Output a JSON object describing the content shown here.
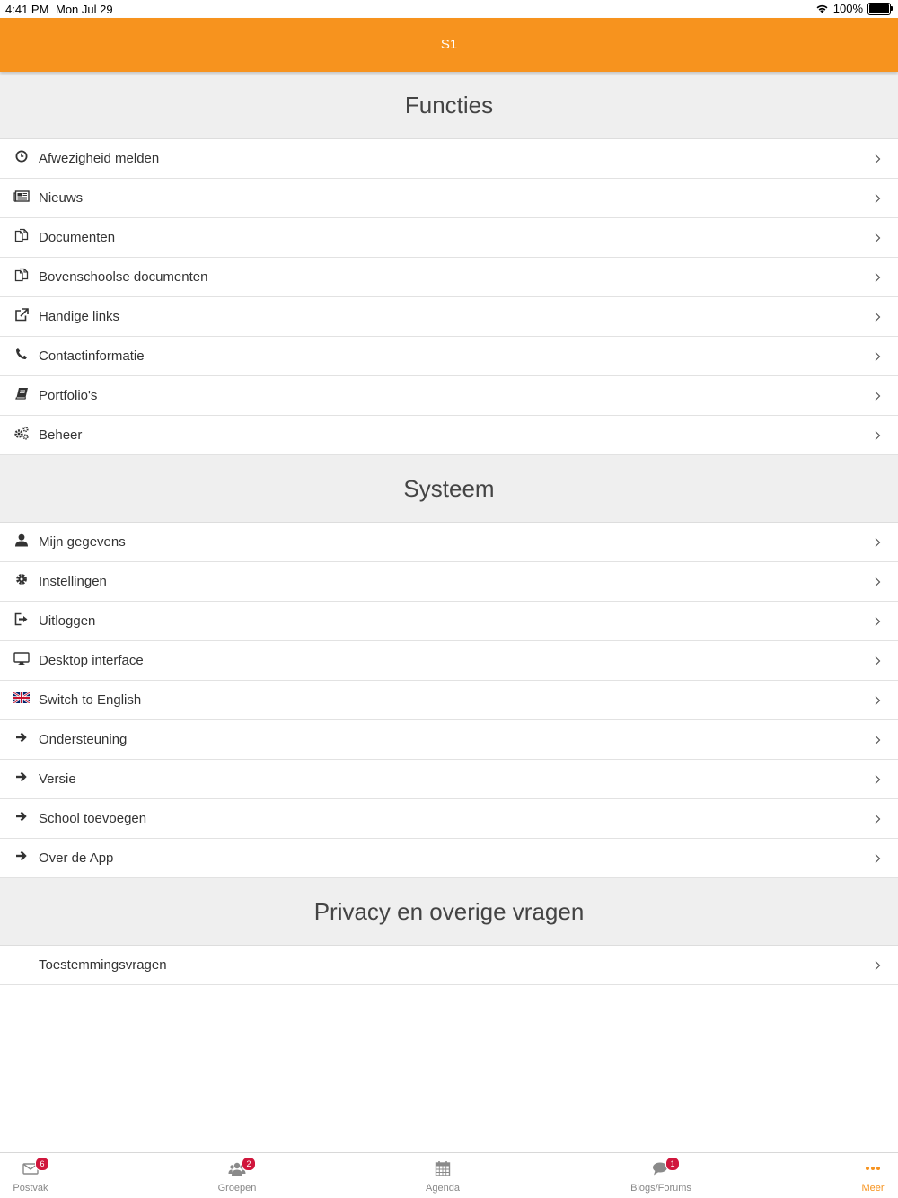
{
  "status_bar": {
    "time": "4:41 PM",
    "date": "Mon Jul 29",
    "battery": "100%"
  },
  "header": {
    "title": "S1",
    "bg_color": "#f7931e"
  },
  "sections": [
    {
      "title": "Functies",
      "items": [
        {
          "label": "Afwezigheid melden",
          "icon": "clock-icon"
        },
        {
          "label": "Nieuws",
          "icon": "newspaper-icon"
        },
        {
          "label": "Documenten",
          "icon": "documents-icon"
        },
        {
          "label": "Bovenschoolse documenten",
          "icon": "documents-icon"
        },
        {
          "label": "Handige links",
          "icon": "external-link-icon"
        },
        {
          "label": "Contactinformatie",
          "icon": "phone-icon"
        },
        {
          "label": "Portfolio's",
          "icon": "book-icon"
        },
        {
          "label": "Beheer",
          "icon": "gears-icon"
        }
      ]
    },
    {
      "title": "Systeem",
      "items": [
        {
          "label": "Mijn gegevens",
          "icon": "user-icon"
        },
        {
          "label": "Instellingen",
          "icon": "gear-icon"
        },
        {
          "label": "Uitloggen",
          "icon": "logout-icon"
        },
        {
          "label": "Desktop interface",
          "icon": "monitor-icon"
        },
        {
          "label": "Switch to English",
          "icon": "uk-flag-icon"
        },
        {
          "label": "Ondersteuning",
          "icon": "arrow-right-icon"
        },
        {
          "label": "Versie",
          "icon": "arrow-right-icon"
        },
        {
          "label": "School toevoegen",
          "icon": "arrow-right-icon"
        },
        {
          "label": "Over de App",
          "icon": "arrow-right-icon"
        }
      ]
    },
    {
      "title": "Privacy en overige vragen",
      "items": [
        {
          "label": "Toestemmingsvragen",
          "icon": ""
        }
      ]
    }
  ],
  "tabbar": {
    "tabs": [
      {
        "label": "Postvak",
        "icon": "envelope-icon",
        "badge": "6",
        "active": false
      },
      {
        "label": "Groepen",
        "icon": "group-icon",
        "badge": "2",
        "active": false
      },
      {
        "label": "Agenda",
        "icon": "calendar-icon",
        "badge": "",
        "active": false
      },
      {
        "label": "Blogs/Forums",
        "icon": "comments-icon",
        "badge": "1",
        "active": false
      },
      {
        "label": "Meer",
        "icon": "more-icon",
        "badge": "",
        "active": true
      }
    ],
    "active_color": "#f7931e",
    "badge_color": "#d0163c"
  }
}
